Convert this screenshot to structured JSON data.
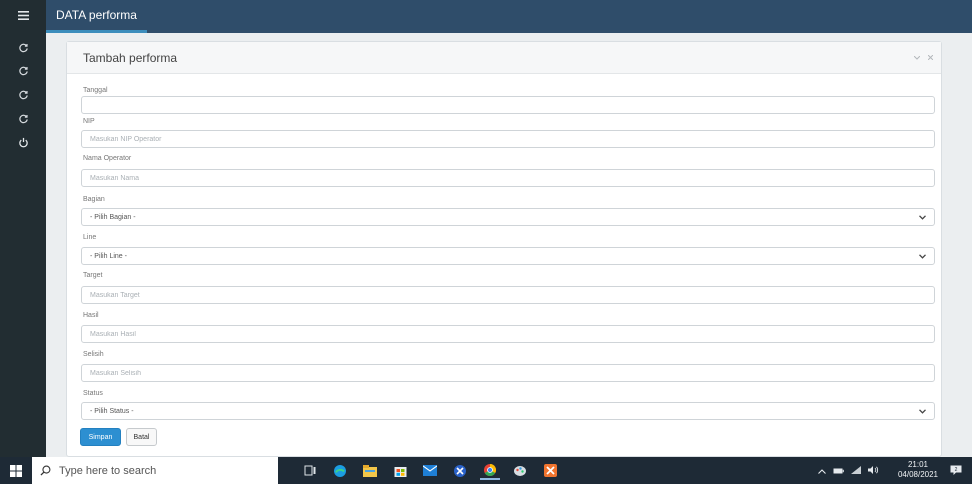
{
  "app": {
    "tab_title": "DATA performa"
  },
  "sidebar": {
    "menu_icon": "hamburger-icon",
    "items": [
      {
        "icon": "refresh-icon"
      },
      {
        "icon": "refresh-icon"
      },
      {
        "icon": "refresh-icon"
      },
      {
        "icon": "refresh-icon"
      },
      {
        "icon": "power-icon"
      }
    ]
  },
  "form": {
    "title": "Tambah performa",
    "fields": {
      "tanggal": {
        "label": "Tanggal",
        "value": "",
        "placeholder": ""
      },
      "nip": {
        "label": "NIP",
        "placeholder": "Masukan NIP Operator"
      },
      "nama": {
        "label": "Nama Operator",
        "placeholder": "Masukan Nama"
      },
      "bagian": {
        "label": "Bagian",
        "selected": "- Pilih Bagian -"
      },
      "line": {
        "label": "Line",
        "selected": "- Pilih Line -"
      },
      "target": {
        "label": "Target",
        "placeholder": "Masukan Target"
      },
      "hasil": {
        "label": "Hasil",
        "placeholder": "Masukan Hasil"
      },
      "selisih": {
        "label": "Selisih",
        "placeholder": "Masukan Selisih"
      },
      "status": {
        "label": "Status",
        "selected": "- Pilih Status -"
      }
    },
    "submit_label": "Simpan",
    "cancel_label": "Batal"
  },
  "taskbar": {
    "search_placeholder": "Type here to search",
    "time": "21:01",
    "date": "04/08/2021"
  },
  "colors": {
    "header": "#2f4d6a",
    "sidebar": "#222d32",
    "primary_button": "#2d8fd1",
    "taskbar": "#1e2a36"
  }
}
